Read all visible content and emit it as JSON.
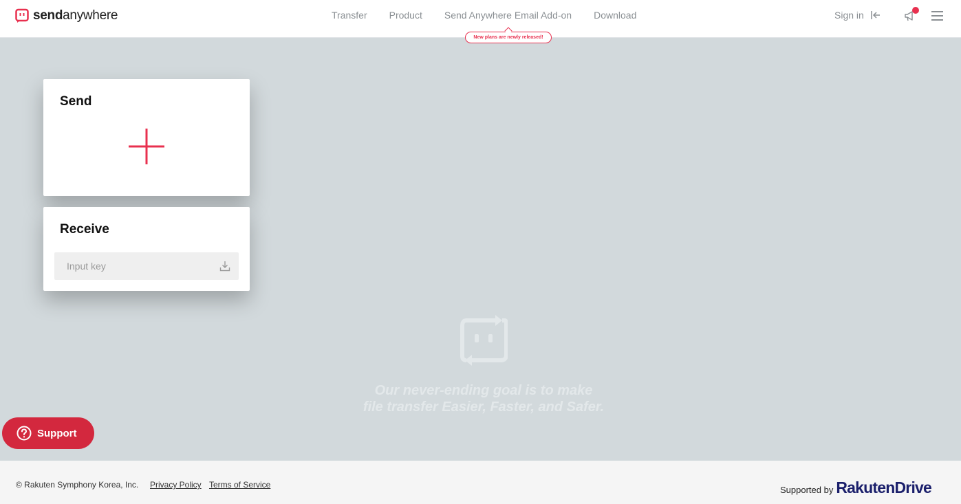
{
  "header": {
    "logo_bold": "send",
    "logo_rest": "anywhere",
    "nav": [
      {
        "label": "Transfer"
      },
      {
        "label": "Product"
      },
      {
        "label": "Send Anywhere Email Add-on"
      },
      {
        "label": "Download"
      }
    ],
    "badge": "New plans are newly released!",
    "signin": "Sign in"
  },
  "send": {
    "title": "Send"
  },
  "receive": {
    "title": "Receive",
    "input_placeholder": "Input key"
  },
  "slogan": {
    "line1": "Our never-ending goal is to make",
    "line2": "file transfer Easier, Faster, and Safer."
  },
  "support": {
    "label": "Support"
  },
  "footer": {
    "copyright": "© Rakuten Symphony Korea, Inc.",
    "privacy": "Privacy Policy",
    "terms": "Terms of Service",
    "supported_by": "Supported by",
    "brand_a": "Rakuten",
    "brand_b": "Drive"
  },
  "colors": {
    "accent": "#e8304f",
    "support": "#d3283e",
    "background": "#d2d9dc"
  }
}
